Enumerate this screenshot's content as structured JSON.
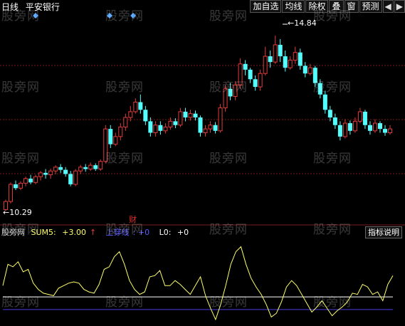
{
  "header": {
    "period": "日线",
    "stock_name": "平安银行"
  },
  "toolbar": [
    "加自选",
    "均线",
    "除权",
    "叠",
    "窗",
    "预测"
  ],
  "nav": {
    "prev": "◀",
    "next": "▶"
  },
  "price_labels": {
    "high": "14.84",
    "low": "10.29"
  },
  "event_marker": "财",
  "indicator": {
    "name": "股旁网",
    "sum_label": "SUM5:",
    "sum_value": "+3.00",
    "up_label": "上穿线",
    "up_value": "+0",
    "l0_label": "L0:",
    "l0_value": "+0",
    "help": "指标说明"
  },
  "watermark": "股旁网",
  "colors": {
    "up": "#e03c3c",
    "down": "#54ffff",
    "sum_line": "#ffff6a",
    "zero_line": "#ffffff",
    "l0_line": "#4b3ce0",
    "grid": "#7a1c1c",
    "sum_value": "#ffff6a",
    "up_label": "#5a5aff",
    "marker": "#4aa0ff"
  },
  "chart_data": [
    {
      "type": "candlestick",
      "price_high": 14.84,
      "price_low": 10.29,
      "ylim": [
        10.0,
        15.4
      ],
      "candles": [
        [
          10.29,
          10.5,
          10.25,
          10.55
        ],
        [
          10.5,
          10.95,
          10.45,
          11.0
        ],
        [
          10.95,
          10.85,
          10.8,
          11.05
        ],
        [
          10.85,
          10.98,
          10.8,
          11.03
        ],
        [
          10.98,
          11.1,
          10.9,
          11.15
        ],
        [
          11.1,
          11.0,
          10.95,
          11.2
        ],
        [
          11.0,
          11.15,
          10.95,
          11.2
        ],
        [
          11.15,
          11.25,
          11.05,
          11.3
        ],
        [
          11.25,
          11.2,
          11.1,
          11.35
        ],
        [
          11.2,
          11.3,
          11.1,
          11.36
        ],
        [
          11.3,
          11.4,
          11.22,
          11.45
        ],
        [
          11.4,
          11.33,
          11.25,
          11.48
        ],
        [
          11.33,
          11.22,
          11.15,
          11.4
        ],
        [
          11.22,
          10.95,
          10.9,
          11.3
        ],
        [
          10.95,
          11.3,
          10.9,
          11.35
        ],
        [
          11.3,
          11.4,
          11.22,
          11.46
        ],
        [
          11.4,
          11.35,
          11.28,
          11.48
        ],
        [
          11.35,
          11.45,
          11.3,
          11.52
        ],
        [
          11.45,
          11.35,
          11.3,
          11.5
        ],
        [
          11.35,
          11.55,
          11.3,
          11.6
        ],
        [
          11.55,
          12.4,
          11.5,
          12.5
        ],
        [
          12.4,
          12.0,
          11.9,
          12.5
        ],
        [
          12.0,
          12.2,
          11.95,
          12.3
        ],
        [
          12.2,
          12.45,
          12.1,
          12.55
        ],
        [
          12.45,
          12.7,
          12.35,
          12.8
        ],
        [
          12.7,
          12.85,
          12.6,
          13.0
        ],
        [
          12.85,
          13.1,
          12.8,
          13.2
        ],
        [
          13.1,
          12.9,
          12.8,
          13.3
        ],
        [
          12.9,
          12.6,
          12.5,
          13.0
        ],
        [
          12.6,
          12.3,
          12.2,
          12.7
        ],
        [
          12.3,
          12.5,
          12.2,
          12.6
        ],
        [
          12.5,
          12.35,
          12.25,
          12.6
        ],
        [
          12.35,
          12.45,
          12.28,
          12.55
        ],
        [
          12.45,
          12.6,
          12.38,
          12.7
        ],
        [
          12.6,
          12.5,
          12.42,
          12.68
        ],
        [
          12.5,
          12.85,
          12.45,
          12.95
        ],
        [
          12.85,
          12.7,
          12.6,
          12.95
        ],
        [
          12.7,
          12.8,
          12.62,
          12.9
        ],
        [
          12.8,
          12.7,
          12.62,
          12.88
        ],
        [
          12.7,
          12.3,
          12.2,
          12.75
        ],
        [
          12.3,
          12.4,
          12.2,
          12.5
        ],
        [
          12.4,
          12.5,
          12.3,
          12.6
        ],
        [
          12.5,
          12.35,
          12.28,
          12.58
        ],
        [
          12.35,
          12.95,
          12.3,
          13.05
        ],
        [
          12.95,
          13.45,
          12.85,
          13.55
        ],
        [
          13.45,
          13.25,
          13.15,
          13.6
        ],
        [
          13.25,
          13.55,
          13.15,
          13.65
        ],
        [
          13.55,
          14.1,
          13.45,
          14.25
        ],
        [
          14.1,
          13.95,
          13.8,
          14.2
        ],
        [
          13.95,
          13.7,
          13.6,
          14.0
        ],
        [
          13.7,
          13.5,
          13.4,
          13.8
        ],
        [
          13.5,
          13.85,
          13.4,
          13.95
        ],
        [
          13.85,
          14.3,
          13.8,
          14.55
        ],
        [
          14.3,
          14.15,
          14.0,
          14.45
        ],
        [
          14.15,
          14.6,
          14.1,
          14.84
        ],
        [
          14.6,
          14.3,
          14.15,
          14.75
        ],
        [
          14.3,
          14.0,
          13.9,
          14.45
        ],
        [
          14.0,
          14.2,
          13.95,
          14.3
        ],
        [
          14.2,
          14.4,
          14.1,
          14.55
        ],
        [
          14.4,
          14.05,
          13.95,
          14.5
        ],
        [
          14.05,
          13.85,
          13.75,
          14.15
        ],
        [
          13.85,
          14.0,
          13.8,
          14.1
        ],
        [
          14.0,
          13.6,
          13.5,
          14.05
        ],
        [
          13.6,
          13.3,
          13.2,
          13.7
        ],
        [
          13.3,
          12.9,
          12.8,
          13.4
        ],
        [
          12.9,
          12.7,
          12.6,
          13.0
        ],
        [
          12.7,
          12.5,
          12.4,
          12.8
        ],
        [
          12.5,
          12.2,
          12.1,
          12.6
        ],
        [
          12.2,
          12.55,
          12.15,
          12.65
        ],
        [
          12.55,
          12.35,
          12.25,
          12.62
        ],
        [
          12.35,
          12.6,
          12.3,
          12.7
        ],
        [
          12.6,
          12.85,
          12.55,
          12.95
        ],
        [
          12.85,
          12.5,
          12.4,
          12.9
        ],
        [
          12.5,
          12.35,
          12.25,
          12.6
        ],
        [
          12.35,
          12.55,
          12.3,
          12.65
        ],
        [
          12.55,
          12.4,
          12.3,
          12.6
        ],
        [
          12.4,
          12.3,
          12.22,
          12.5
        ],
        [
          12.3,
          12.4,
          12.25,
          12.5
        ]
      ]
    },
    {
      "type": "line",
      "series": [
        {
          "name": "SUM5",
          "values": [
            0.9,
            2.6,
            2.4,
            2.8,
            2.0,
            2.2,
            1.1,
            0.6,
            0.3,
            0.2,
            0.1,
            0.7,
            0.9,
            1.1,
            1.2,
            1.1,
            0.6,
            0.4,
            0.3,
            1.0,
            2.2,
            2.4,
            3.2,
            3.6,
            2.6,
            1.3,
            0.6,
            0.2,
            0.4,
            1.6,
            1.7,
            2.1,
            0.9,
            0.9,
            1.3,
            1.0,
            0.6,
            0.2,
            0.9,
            1.6,
            0.1,
            -0.9,
            -1.8,
            -0.6,
            0.9,
            2.6,
            3.6,
            4.0,
            2.6,
            1.5,
            0.8,
            0.2,
            -0.6,
            -1.6,
            -1.3,
            -0.4,
            0.8,
            1.3,
            0.9,
            0.2,
            -0.5,
            -1.2,
            -0.8,
            -0.3,
            -0.9,
            -1.5,
            -1.1,
            -0.8,
            -0.4,
            0.3,
            0.2,
            1.0,
            0.8,
            0.2,
            0.4,
            -0.3,
            1.0,
            1.7
          ]
        },
        {
          "name": "上穿线",
          "values": [
            0,
            0,
            0,
            0,
            0,
            0,
            0,
            0,
            0,
            0,
            0,
            0,
            0,
            0,
            0,
            0,
            0,
            0,
            0,
            0,
            0,
            0,
            0,
            0,
            0,
            0,
            0,
            0,
            0,
            0,
            0,
            0,
            0,
            0,
            0,
            0,
            0,
            0,
            0,
            0,
            0,
            0,
            0,
            0,
            0,
            0,
            0,
            0,
            0,
            0,
            0,
            0,
            0,
            0,
            0,
            0,
            0,
            0,
            0,
            0,
            0,
            0,
            0,
            0,
            0,
            0,
            0,
            0,
            0,
            0,
            0,
            0,
            0,
            0,
            0,
            0,
            0,
            0
          ]
        },
        {
          "name": "L0",
          "values": [
            -1,
            -1,
            -1,
            -1,
            -1,
            -1,
            -1,
            -1,
            -1,
            -1,
            -1,
            -1,
            -1,
            -1,
            -1,
            -1,
            -1,
            -1,
            -1,
            -1,
            -1,
            -1,
            -1,
            -1,
            -1,
            -1,
            -1,
            -1,
            -1,
            -1,
            -1,
            -1,
            -1,
            -1,
            -1,
            -1,
            -1,
            -1,
            -1,
            -1,
            -1,
            -1,
            -1,
            -1,
            -1,
            -1,
            -1,
            -1,
            -1,
            -1,
            -1,
            -1,
            -1,
            -1,
            -1,
            -1,
            -1,
            -1,
            -1,
            -1,
            -1,
            -1,
            -1,
            -1,
            -1,
            -1,
            -1,
            -1,
            -1,
            -1,
            -1,
            -1,
            -1,
            -1,
            -1,
            -1,
            -1,
            -1
          ]
        }
      ],
      "ylim": [
        -2.2,
        4.6
      ]
    }
  ]
}
